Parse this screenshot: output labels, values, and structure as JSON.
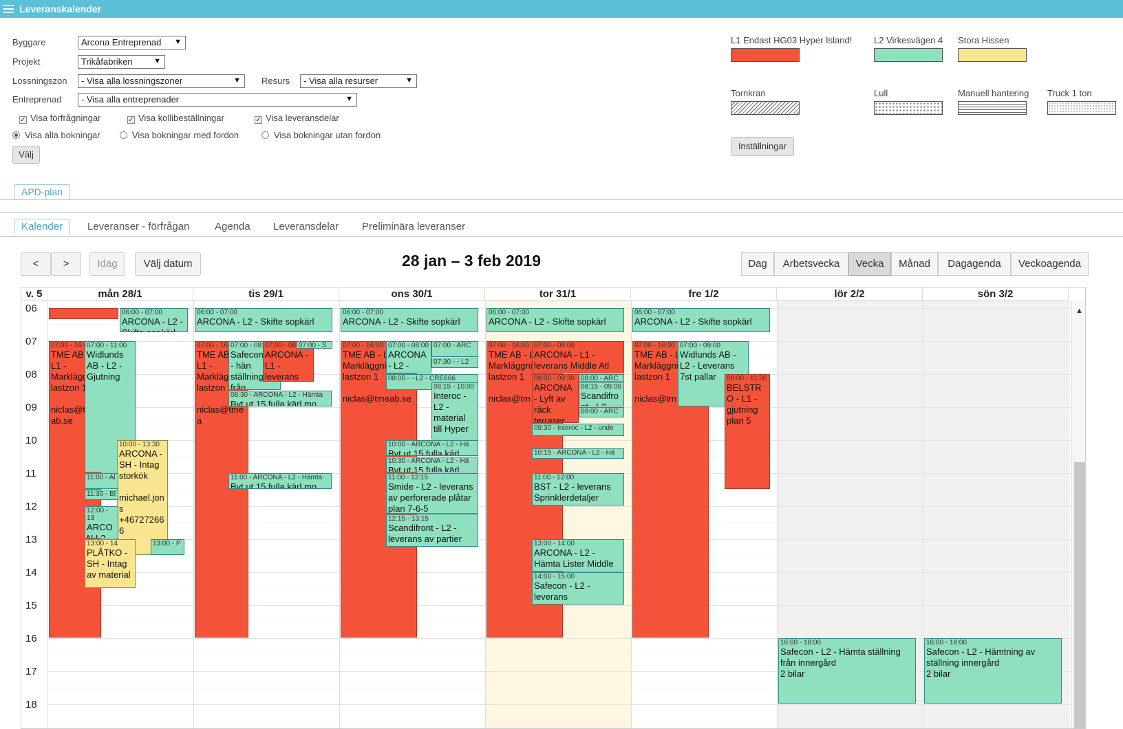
{
  "app": {
    "title": "Leveranskalender"
  },
  "filters": {
    "byggare_label": "Byggare",
    "byggare_value": "Arcona Entreprenad",
    "projekt_label": "Projekt",
    "projekt_value": "Trikåfabriken",
    "lossningszon_label": "Lossningszon",
    "lossningszon_value": "- Visa alla lossningszoner",
    "resurs_label": "Resurs",
    "resurs_value": "- Visa alla resurser",
    "entreprenad_label": "Entreprenad",
    "entreprenad_value": "- Visa alla entreprenader",
    "checkboxes": [
      "Visa förfrågningar",
      "Visa kollibeställningar",
      "Visa leveransdelar"
    ],
    "radios": [
      "Visa alla bokningar",
      "Visa bokningar med fordon",
      "Visa bokningar utan fordon"
    ],
    "select_button": "Välj"
  },
  "legend": {
    "items": [
      {
        "label": "L1 Endast HG03 Hyper Island!",
        "color": "#f4533a"
      },
      {
        "label": "L2 Virkesvägen 4",
        "color": "#8fe0bf"
      },
      {
        "label": "Stora Hissen",
        "color": "#f9e58f"
      },
      {
        "label": "Tornkran",
        "pattern": "diagonal-hatch"
      },
      {
        "label": "Lull",
        "pattern": "dots"
      },
      {
        "label": "Manuell hantering",
        "pattern": "horizontal-lines"
      },
      {
        "label": "Truck 1 ton",
        "pattern": "fine-dots"
      }
    ],
    "settings_button": "Inställningar"
  },
  "apd_tab": "APD-plan",
  "tabs": [
    "Kalender",
    "Leveranser - förfrågan",
    "Agenda",
    "Leveransdelar",
    "Preliminära leveranser"
  ],
  "calendar": {
    "range_title": "28 jan – 3 feb 2019",
    "nav": {
      "prev": "<",
      "next": ">",
      "today": "Idag",
      "choose_date": "Välj datum"
    },
    "views": [
      "Dag",
      "Arbetsvecka",
      "Vecka",
      "Månad",
      "Dagagenda",
      "Veckoagenda"
    ],
    "active_view": "Vecka",
    "week_label": "v. 5",
    "days": [
      "mån 28/1",
      "tis 29/1",
      "ons 30/1",
      "tor 31/1",
      "fre 1/2",
      "lör 2/2",
      "sön 3/2"
    ],
    "hours": [
      "06",
      "07",
      "08",
      "09",
      "10",
      "11",
      "12",
      "13",
      "14",
      "15",
      "16",
      "17",
      "18"
    ],
    "events": [
      {
        "d": 0,
        "s": 6.0,
        "e": 6.37,
        "x": 0,
        "w": 0.49,
        "c": "red",
        "time": "",
        "text": ""
      },
      {
        "d": 0,
        "s": 6.0,
        "e": 6.75,
        "x": 0.5,
        "w": 0.48,
        "c": "green",
        "time": "06:00 - 07:00",
        "text": "ARCONA - L2 - Skifte sopkärl"
      },
      {
        "d": 0,
        "s": 7.0,
        "e": 16.0,
        "x": 0,
        "w": 0.37,
        "c": "red",
        "time": "07:00 - 16:00",
        "text": "TME AB - L1 - Marklägg lastzon 1\n\nniclas@tmeab.se"
      },
      {
        "d": 0,
        "s": 7.0,
        "e": 11.0,
        "x": 0.25,
        "w": 0.36,
        "c": "green",
        "time": "07:00 - 11:00",
        "text": "Widlunds AB - L2 - Gjutning"
      },
      {
        "d": 0,
        "s": 10.0,
        "e": 13.5,
        "x": 0.48,
        "w": 0.36,
        "c": "yellow",
        "time": "10:00 - 13:30",
        "text": "ARCONA - SH - Intag storkök\n\nmichael.jons +467272666"
      },
      {
        "d": 0,
        "s": 11.0,
        "e": 11.5,
        "x": 0.25,
        "w": 0.24,
        "c": "green",
        "time": "11:00 - Al",
        "text": ""
      },
      {
        "d": 0,
        "s": 11.5,
        "e": 11.85,
        "x": 0.25,
        "w": 0.24,
        "c": "green",
        "time": "11:30 - Bl",
        "text": ""
      },
      {
        "d": 0,
        "s": 12.0,
        "e": 13.0,
        "x": 0.25,
        "w": 0.24,
        "c": "green",
        "time": "12:00 - 13",
        "text": "ARCON L2 -"
      },
      {
        "d": 0,
        "s": 13.0,
        "e": 14.5,
        "x": 0.25,
        "w": 0.36,
        "c": "yellow",
        "time": "13:00 - 14",
        "text": "PLÅTKO - SH - Intag av material"
      },
      {
        "d": 0,
        "s": 13.0,
        "e": 13.5,
        "x": 0.72,
        "w": 0.24,
        "c": "green",
        "time": "13:00 - P",
        "text": ""
      },
      {
        "d": 1,
        "s": 6.0,
        "e": 6.75,
        "x": 0,
        "w": 0.97,
        "c": "green",
        "time": "06:00 - 07:00",
        "text": "ARCONA - L2 - Skifte sopkärl"
      },
      {
        "d": 1,
        "s": 7.0,
        "e": 16.0,
        "x": 0,
        "w": 0.38,
        "c": "red",
        "time": "07:00 - 16:00",
        "text": "TME AB - L1 - Marklägg lastzon\n\nniclas@tmea"
      },
      {
        "d": 1,
        "s": 7.0,
        "e": 8.5,
        "x": 0.24,
        "w": 0.37,
        "c": "green",
        "time": "07:00 - 08:00",
        "text": "Safecon L2 - hän ställning från"
      },
      {
        "d": 1,
        "s": 7.0,
        "e": 8.25,
        "x": 0.48,
        "w": 0.36,
        "c": "red",
        "time": "07:00 - 08:00",
        "text": "ARCONA - L1 - leverans"
      },
      {
        "d": 1,
        "s": 7.0,
        "e": 7.25,
        "x": 0.72,
        "w": 0.25,
        "c": "green",
        "time": "07:00 - S",
        "text": ""
      },
      {
        "d": 1,
        "s": 8.5,
        "e": 9.0,
        "x": 0.24,
        "w": 0.73,
        "c": "green",
        "time": "08:30 - ARCONA - L2 - Hämta",
        "text": "Byt ut 15 fulla kärl mo"
      },
      {
        "d": 1,
        "s": 11.0,
        "e": 11.5,
        "x": 0.24,
        "w": 0.73,
        "c": "green",
        "time": "11:00 - ARCONA - L2 - Hämta",
        "text": "Byt ut 15 fulla kärl mo"
      },
      {
        "d": 2,
        "s": 6.0,
        "e": 6.75,
        "x": 0,
        "w": 0.97,
        "c": "green",
        "time": "06:00 - 07:00",
        "text": "ARCONA - L2 - Skifte sopkärl"
      },
      {
        "d": 2,
        "s": 7.0,
        "e": 16.0,
        "x": 0,
        "w": 0.54,
        "c": "red",
        "time": "07:00 - 16:00",
        "text": "TME AB - L1 - Markläggning lastzon 1\n\nniclas@tmeab.se"
      },
      {
        "d": 2,
        "s": 7.0,
        "e": 8.0,
        "x": 0.32,
        "w": 0.32,
        "c": "green",
        "time": "07:00 - 08:00",
        "text": "ARCONA - L2 - Leverans M"
      },
      {
        "d": 2,
        "s": 7.0,
        "e": 7.5,
        "x": 0.64,
        "w": 0.33,
        "c": "green",
        "time": "07:00 - ARC",
        "text": ""
      },
      {
        "d": 2,
        "s": 7.5,
        "e": 7.85,
        "x": 0.64,
        "w": 0.33,
        "c": "green",
        "time": "07:30 - - L2",
        "text": ""
      },
      {
        "d": 2,
        "s": 8.0,
        "e": 8.5,
        "x": 0.32,
        "w": 0.65,
        "c": "green",
        "time": "08:00 - - L2 - CRE666",
        "text": ""
      },
      {
        "d": 2,
        "s": 8.25,
        "e": 10.0,
        "x": 0.64,
        "w": 0.33,
        "c": "green",
        "time": "08:15 - 10:00",
        "text": "Interoc - L2 - material till Hyper"
      },
      {
        "d": 2,
        "s": 10.0,
        "e": 10.5,
        "x": 0.32,
        "w": 0.65,
        "c": "green",
        "time": "10:00 - ARCONA - L2 - Hä",
        "text": "Byt ut 15 fulla kärl"
      },
      {
        "d": 2,
        "s": 10.5,
        "e": 11.0,
        "x": 0.32,
        "w": 0.65,
        "c": "green",
        "time": "10:30 - ARCONA - L2 - Hä",
        "text": "Byt ut 15 fulla kärl"
      },
      {
        "d": 2,
        "s": 11.0,
        "e": 12.25,
        "x": 0.32,
        "w": 0.65,
        "c": "green",
        "time": "11:00 - 12:15",
        "text": "Smide - L2 - leverans av perforerade plåtar plan 7-6-5"
      },
      {
        "d": 2,
        "s": 12.25,
        "e": 13.25,
        "x": 0.32,
        "w": 0.65,
        "c": "green",
        "time": "12:15 - 13:15",
        "text": "Scandifront - L2 - leverans av partier"
      },
      {
        "d": 3,
        "s": 6.0,
        "e": 6.75,
        "x": 0,
        "w": 0.97,
        "c": "green",
        "time": "06:00 - 07:00",
        "text": "ARCONA - L2 - Skifte sopkärl"
      },
      {
        "d": 3,
        "s": 7.0,
        "e": 16.0,
        "x": 0,
        "w": 0.54,
        "c": "red",
        "time": "07:00 - 16:00",
        "text": "TME AB - L1 - Markläggni lastzon 1\n\nniclas@tm"
      },
      {
        "d": 3,
        "s": 7.0,
        "e": 8.0,
        "x": 0.32,
        "w": 0.65,
        "c": "red",
        "time": "07:00 - 08:00",
        "text": "ARCONA - L1 - leverans Middle Atl"
      },
      {
        "d": 3,
        "s": 8.0,
        "e": 9.5,
        "x": 0.32,
        "w": 0.33,
        "c": "red",
        "time": "08:00 - 09:30",
        "text": "ARCONA - Lyft av räck terraser"
      },
      {
        "d": 3,
        "s": 8.0,
        "e": 8.25,
        "x": 0.65,
        "w": 0.32,
        "c": "green",
        "time": "08:00 - ARC",
        "text": ""
      },
      {
        "d": 3,
        "s": 8.25,
        "e": 9.0,
        "x": 0.65,
        "w": 0.32,
        "c": "green",
        "time": "08:15 - 09:00",
        "text": "Scandifront - L2"
      },
      {
        "d": 3,
        "s": 9.0,
        "e": 9.35,
        "x": 0.65,
        "w": 0.32,
        "c": "green",
        "time": "09:00 - ARC",
        "text": ""
      },
      {
        "d": 3,
        "s": 9.5,
        "e": 9.9,
        "x": 0.32,
        "w": 0.65,
        "c": "green",
        "time": "09:30 - Interoc - L2 - unde",
        "text": ""
      },
      {
        "d": 3,
        "s": 10.25,
        "e": 10.6,
        "x": 0.32,
        "w": 0.65,
        "c": "green",
        "time": "10:15 - ARCONA - L2 - Hä",
        "text": ""
      },
      {
        "d": 3,
        "s": 11.0,
        "e": 12.0,
        "x": 0.32,
        "w": 0.65,
        "c": "green",
        "time": "11:00 - 12:00",
        "text": "BST - L2 - leverans Sprinklerdetaljer"
      },
      {
        "d": 3,
        "s": 13.0,
        "e": 14.0,
        "x": 0.32,
        "w": 0.65,
        "c": "green",
        "time": "13:00 - 14:00",
        "text": "ARCONA - L2 - Hämta Lister Middle"
      },
      {
        "d": 3,
        "s": 14.0,
        "e": 15.0,
        "x": 0.32,
        "w": 0.65,
        "c": "green",
        "time": "14:00 - 15:00",
        "text": "Safecon - L2 - leverans"
      },
      {
        "d": 4,
        "s": 6.0,
        "e": 6.75,
        "x": 0,
        "w": 0.97,
        "c": "green",
        "time": "06:00 - 07:00",
        "text": "ARCONA - L2 - Skifte sopkärl"
      },
      {
        "d": 4,
        "s": 7.0,
        "e": 16.0,
        "x": 0,
        "w": 0.54,
        "c": "red",
        "time": "07:00 - 16:00",
        "text": "TME AB - L1 - Markläggni lastzon 1\n\nniclas@tm"
      },
      {
        "d": 4,
        "s": 7.0,
        "e": 9.0,
        "x": 0.32,
        "w": 0.5,
        "c": "green",
        "time": "07:00 - 09:00",
        "text": "Widlunds AB - L2 - Leverans 7st pallar"
      },
      {
        "d": 4,
        "s": 8.0,
        "e": 11.5,
        "x": 0.65,
        "w": 0.32,
        "c": "red",
        "time": "08:00 - 11:30",
        "text": "BELSTRO - L1 - gjutning plan 5"
      },
      {
        "d": 5,
        "s": 16.0,
        "e": 18.0,
        "x": 0,
        "w": 0.97,
        "c": "green",
        "time": "16:00 - 18:00",
        "text": "Safecon - L2 - Hämta ställning från innergård\n2 bilar"
      },
      {
        "d": 6,
        "s": 16.0,
        "e": 18.0,
        "x": 0,
        "w": 0.97,
        "c": "green",
        "time": "16:00 - 18:00",
        "text": "Safecon - L2 - Hämtning av ställning innergård\n2 bilar"
      }
    ]
  }
}
